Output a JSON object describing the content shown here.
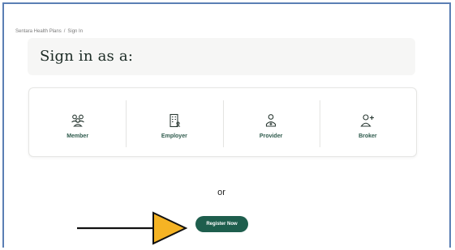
{
  "breadcrumb": {
    "home": "Sentara Health Plans",
    "separator": "/",
    "current": "Sign In"
  },
  "page_title": "Sign in as a:",
  "roles": [
    {
      "label": "Member",
      "icon": "members-icon"
    },
    {
      "label": "Employer",
      "icon": "building-icon"
    },
    {
      "label": "Provider",
      "icon": "doctor-icon"
    },
    {
      "label": "Broker",
      "icon": "user-plus-icon"
    }
  ],
  "or_text": "or",
  "register_label": "Register Now",
  "colors": {
    "brand_green": "#1e5e4d",
    "label_green": "#2e5a4c",
    "arrow_fill": "#f5b324",
    "frame_border": "#5b7fb4"
  }
}
